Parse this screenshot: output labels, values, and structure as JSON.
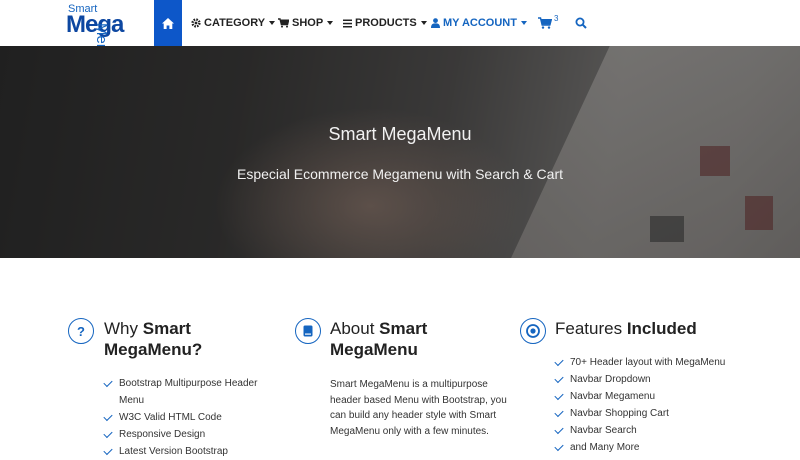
{
  "logo": {
    "smart": "Smart",
    "mega": "Mega",
    "menu": "Menu"
  },
  "nav": {
    "home_icon": "home-icon",
    "items": [
      {
        "label": "CATEGORY",
        "icon": "gear-icon"
      },
      {
        "label": "SHOP",
        "icon": "cart-icon"
      },
      {
        "label": "PRODUCTS",
        "icon": "list-icon"
      },
      {
        "label": "MY ACCOUNT",
        "icon": "user-icon"
      }
    ],
    "cart_badge": "3",
    "accent": "#0d57c9"
  },
  "hero": {
    "title": "Smart MegaMenu",
    "subtitle": "Especial Ecommerce Megamenu with Search & Cart"
  },
  "columns": [
    {
      "icon": "question-icon",
      "title_pre": "Why ",
      "title_bold": "Smart MegaMenu?",
      "items": [
        "Bootstrap Multipurpose Header Menu",
        "W3C Valid HTML Code",
        "Responsive Design",
        "Latest Version Bootstrap"
      ]
    },
    {
      "icon": "book-icon",
      "title_pre": "About ",
      "title_bold": "Smart MegaMenu",
      "text": "Smart MegaMenu is a multipurpose header based Menu with Bootstrap, you can build any header style with Smart MegaMenu only with a few minutes."
    },
    {
      "icon": "target-icon",
      "title_pre": "Features ",
      "title_bold": "Included",
      "items": [
        "70+ Header layout with MegaMenu",
        "Navbar Dropdown",
        "Navbar Megamenu",
        "Navbar Shopping Cart",
        "Navbar Search",
        "and Many More"
      ]
    }
  ]
}
